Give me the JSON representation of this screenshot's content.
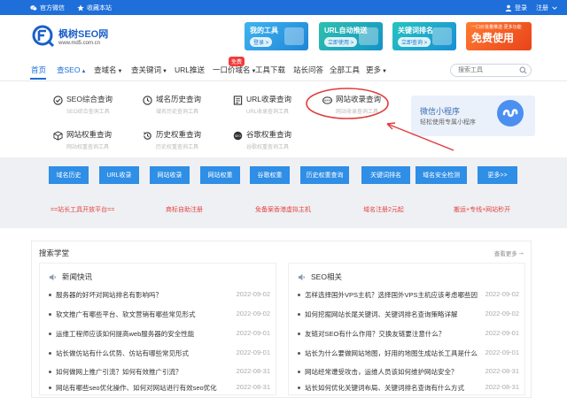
{
  "topbar": {
    "left": [
      {
        "label": "官方微信",
        "icon": "wechat-icon"
      },
      {
        "label": "收藏本站",
        "icon": "star-icon"
      }
    ],
    "right": [
      {
        "label": "登录",
        "icon": "user-icon"
      },
      {
        "label": "注册",
        "icon": "chevron-down-icon"
      }
    ]
  },
  "logo": {
    "name": "枫树SEO网",
    "url": "www.md5.com.cn"
  },
  "banners": [
    {
      "title": "我的工具",
      "button": "登录 >"
    },
    {
      "title": "URL自动推送",
      "button": "立即使用 >"
    },
    {
      "title": "关键词排名",
      "button": "立即查询 >"
    },
    {
      "title": "免费使用",
      "small": "一口价批量推送·更多功能"
    }
  ],
  "nav": {
    "items": [
      "首页",
      "查SEO",
      "查域名",
      "查关键词",
      "URL推送",
      "一口价域名",
      "工具下载",
      "站长问答",
      "全部工具",
      "更多"
    ],
    "hot_badge": "免费",
    "search_placeholder": "搜索工具"
  },
  "tools": [
    {
      "title": "SEO综合查询",
      "sub": "SEO综合查询工具",
      "icon": "circle-check-icon"
    },
    {
      "title": "域名历史查询",
      "sub": "域名历史查询工具",
      "icon": "clock-icon"
    },
    {
      "title": "URL收录查询",
      "sub": "URL收录查询工具",
      "icon": "page-icon"
    },
    {
      "title": "网站收录查询",
      "sub": "网站收录查询工具",
      "icon": "www-icon"
    },
    {
      "title": "网站权重查询",
      "sub": "网站权重查询工具",
      "icon": "cube-icon"
    },
    {
      "title": "历史权重查询",
      "sub": "历史权重查询工具",
      "icon": "history-icon"
    },
    {
      "title": "谷歌权重查询",
      "sub": "谷歌权重查询工具",
      "icon": "seo-icon"
    }
  ],
  "mini_program": {
    "title": "微信小程序",
    "sub": "轻松使用专属小程序"
  },
  "quick_buttons": [
    "域名历史",
    "URL收录",
    "网站收录",
    "网站权重",
    "谷歌权重",
    "历史权重查询",
    "关键词排名",
    "域名安全检测",
    "更多>>"
  ],
  "red_links": [
    "==站长工具开放平台==",
    "商标自助注册",
    "免备案香港虚拟主机",
    "域名注册2元起",
    "搬运+专线+网站秒开"
  ],
  "news": {
    "title": "搜索学堂",
    "more": "查看更多 ⇀",
    "columns": [
      {
        "heading": "新闻快讯",
        "items": [
          {
            "title": "服务器的好坏对网站排名有影响吗？",
            "date": "2022-09-02"
          },
          {
            "title": "软文推广有哪些平台、软文营销有哪些常见形式",
            "date": "2022-09-02"
          },
          {
            "title": "运维工程师应该如何提高web服务器的安全性能",
            "date": "2022-09-01"
          },
          {
            "title": "站长做仿站有什么优势、仿站有哪些常见形式",
            "date": "2022-09-01"
          },
          {
            "title": "如何做网上推广引流？如何有效推广引流？",
            "date": "2022-08-31"
          },
          {
            "title": "网站有哪些seo优化操作、如何对网站进行有效seo优化",
            "date": "2022-08-31"
          }
        ]
      },
      {
        "heading": "SEO相关",
        "items": [
          {
            "title": "怎样选择国外VPS主机？选择国外VPS主机应该考虑哪些因素？",
            "date": "2022-09-02"
          },
          {
            "title": "如何挖掘网站长尾关键词、关键词排名查询策略详解",
            "date": "2022-09-02"
          },
          {
            "title": "友链对SEO有什么作用？交换友链要注意什么？",
            "date": "2022-09-01"
          },
          {
            "title": "站长为什么要做网站地图，好用的地图生成站长工具是什么？",
            "date": "2022-09-01"
          },
          {
            "title": "网站经常遭受攻击，运维人员该如何维护网站安全？",
            "date": "2022-08-31"
          },
          {
            "title": "站长如何优化关键词布局、关键词排名查询有什么方式",
            "date": "2022-08-31"
          }
        ]
      }
    ]
  },
  "colors": {
    "primary": "#1e6fd9",
    "button": "#2f8ee5",
    "red": "#e64242",
    "band": "#eef0f3"
  }
}
